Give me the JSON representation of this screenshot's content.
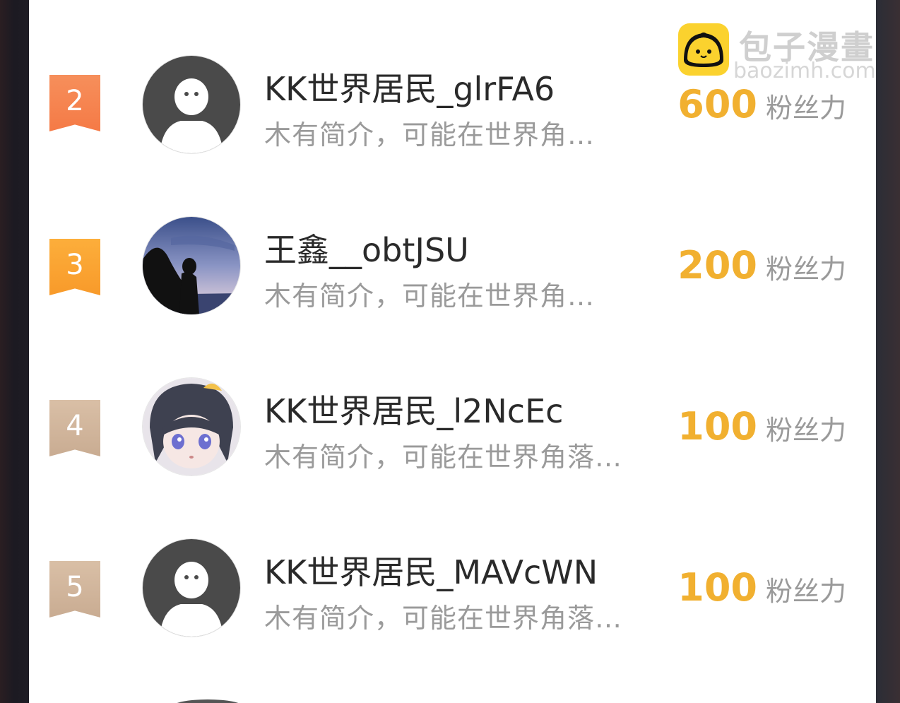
{
  "watermark": {
    "title": "包子漫畫",
    "url": "baozimh.com"
  },
  "list": [
    {
      "rank": "2",
      "name": "KK世界居民_glrFA6",
      "bio": "木有简介，可能在世界角…",
      "fans": "600",
      "unit": "粉丝力"
    },
    {
      "rank": "3",
      "name": "王鑫__obtJSU",
      "bio": "木有简介，可能在世界角…",
      "fans": "200",
      "unit": "粉丝力"
    },
    {
      "rank": "4",
      "name": "KK世界居民_l2NcEc",
      "bio": "木有简介，可能在世界角落…",
      "fans": "100",
      "unit": "粉丝力"
    },
    {
      "rank": "5",
      "name": "KK世界居民_MAVcWN",
      "bio": "木有简介，可能在世界角落…",
      "fans": "100",
      "unit": "粉丝力"
    }
  ],
  "colors": {
    "rank2": "#f57a46",
    "rank3": "#f89a2a",
    "rank_other": "#c9ac92",
    "fans": "#f1b030"
  }
}
